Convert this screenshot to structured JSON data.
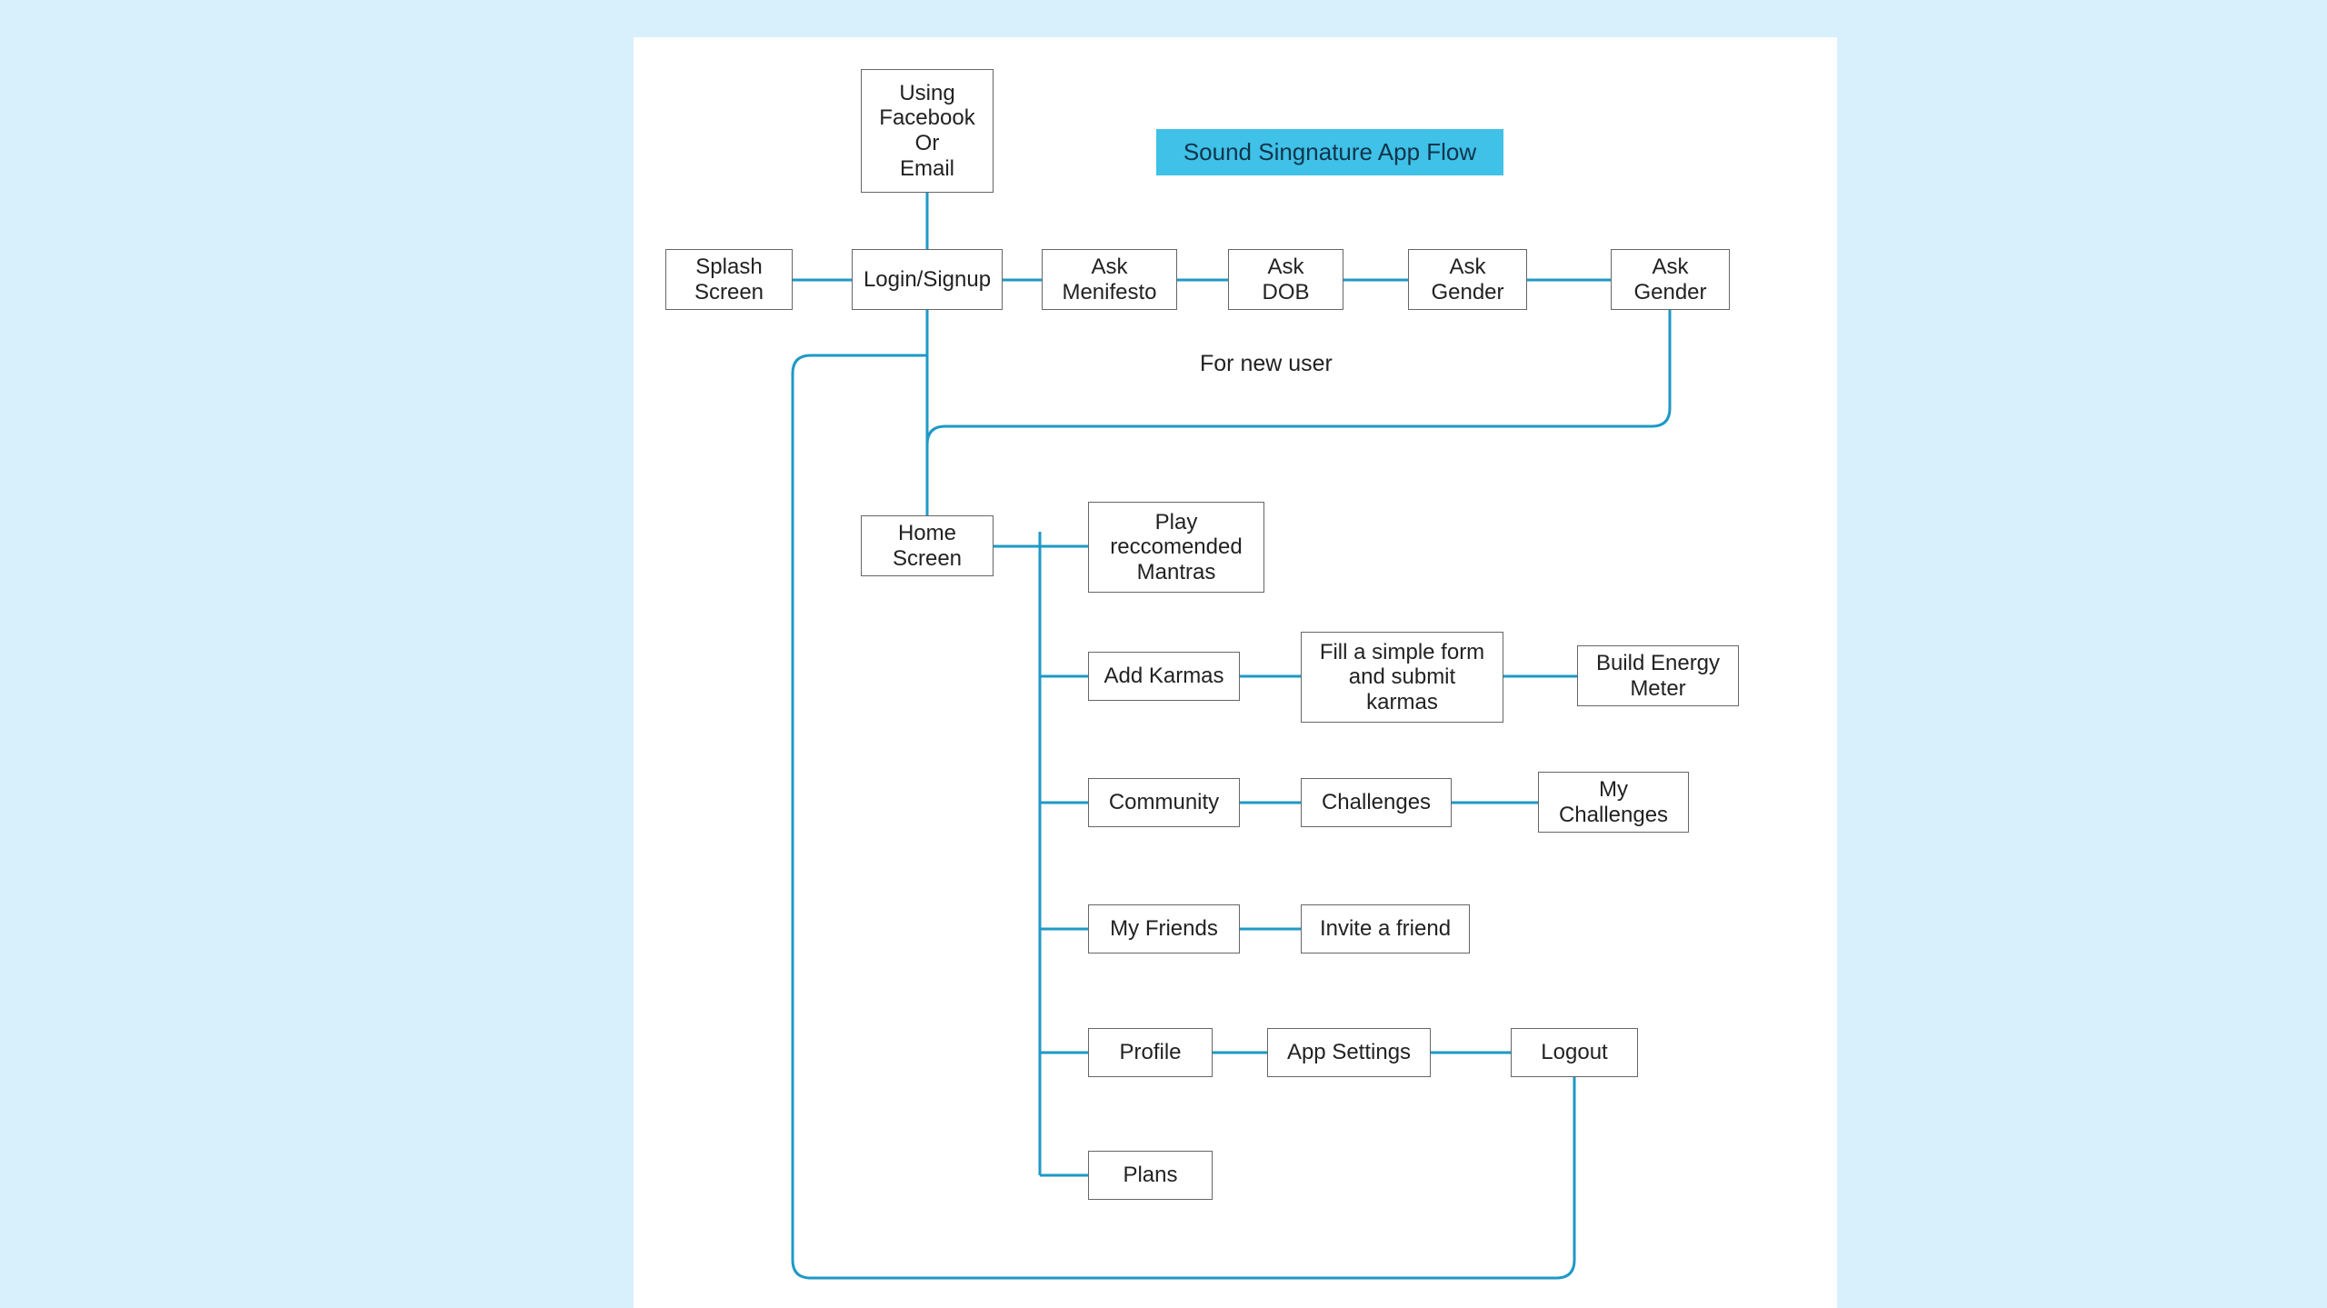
{
  "title": "Sound Singnature App Flow",
  "labels": {
    "for_new_user": "For new user"
  },
  "nodes": {
    "using_fb_email": "Using\nFacebook\nOr\nEmail",
    "splash": "Splash\nScreen",
    "login": "Login/Signup",
    "ask_menifesto": "Ask\nMenifesto",
    "ask_dob": "Ask\nDOB",
    "ask_gender_1": "Ask\nGender",
    "ask_gender_2": "Ask\nGender",
    "home": "Home\nScreen",
    "play_mantras": "Play\nreccomended\nMantras",
    "add_karmas": "Add Karmas",
    "fill_form": "Fill a simple form\nand submit\nkarmas",
    "build_energy": "Build Energy\nMeter",
    "community": "Community",
    "challenges": "Challenges",
    "my_challenges": "My\nChallenges",
    "my_friends": "My Friends",
    "invite_friend": "Invite a friend",
    "profile": "Profile",
    "app_settings": "App Settings",
    "logout": "Logout",
    "plans": "Plans"
  }
}
